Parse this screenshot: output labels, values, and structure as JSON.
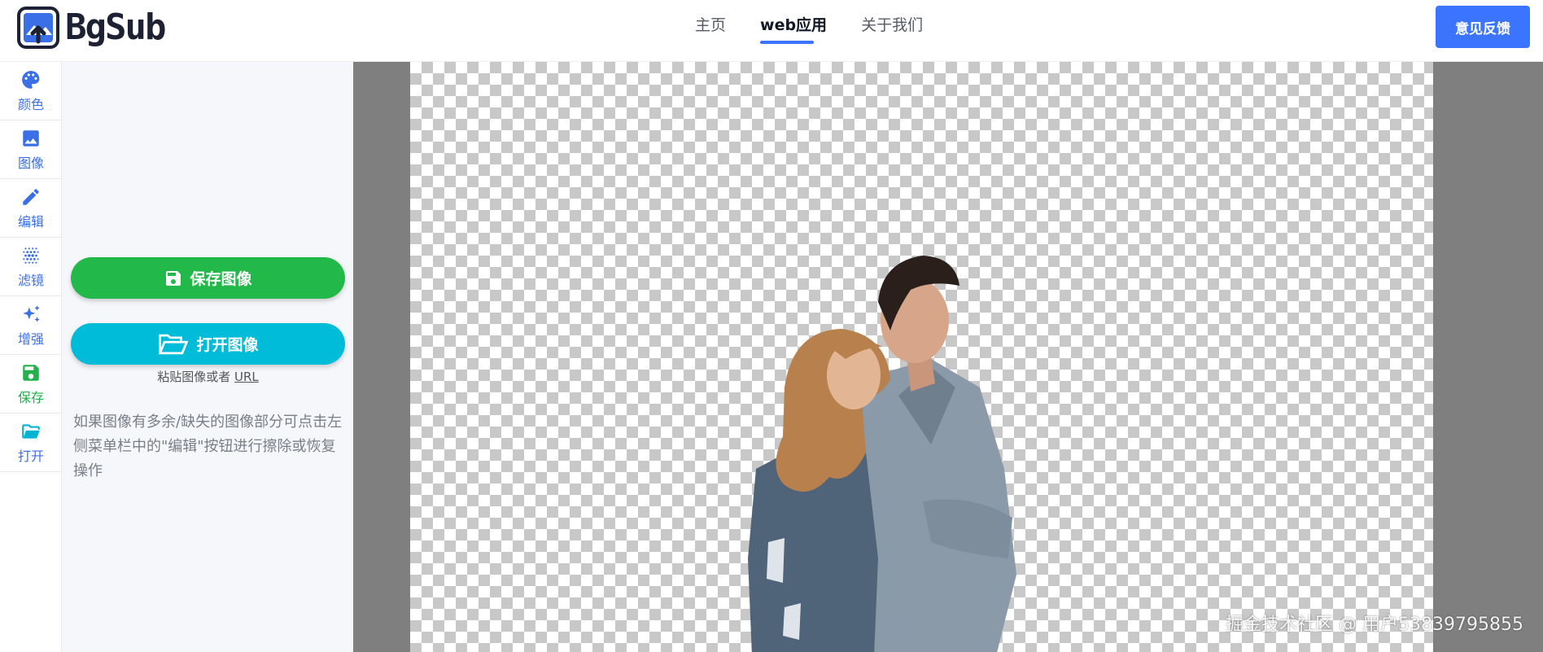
{
  "header": {
    "logo_text": "BgSub",
    "nav": [
      {
        "label": "主页",
        "active": false
      },
      {
        "label": "web应用",
        "active": true
      },
      {
        "label": "关于我们",
        "active": false
      }
    ],
    "feedback_label": "意见反馈",
    "accent_color": "#3b74ff"
  },
  "rail": {
    "items": [
      {
        "label": "颜色",
        "icon": "palette-icon"
      },
      {
        "label": "图像",
        "icon": "image-icon"
      },
      {
        "label": "编辑",
        "icon": "pencil-icon"
      },
      {
        "label": "滤镜",
        "icon": "filter-dots-icon"
      },
      {
        "label": "增强",
        "icon": "sparkle-icon"
      },
      {
        "label": "保存",
        "icon": "floppy-icon"
      },
      {
        "label": "打开",
        "icon": "folder-open-icon"
      }
    ]
  },
  "panel": {
    "save_label": "保存图像",
    "open_label": "打开图像",
    "paste_text": "粘贴图像或者",
    "paste_url": "URL",
    "hint": "如果图像有多余/缺失的图像部分可点击左侧菜单栏中的\"编辑\"按钮进行擦除或恢复操作",
    "save_color": "#22b94a",
    "open_color": "#00bcd9"
  },
  "canvas": {
    "watermark": "掘金技术社区 @ 用户53839795855"
  }
}
